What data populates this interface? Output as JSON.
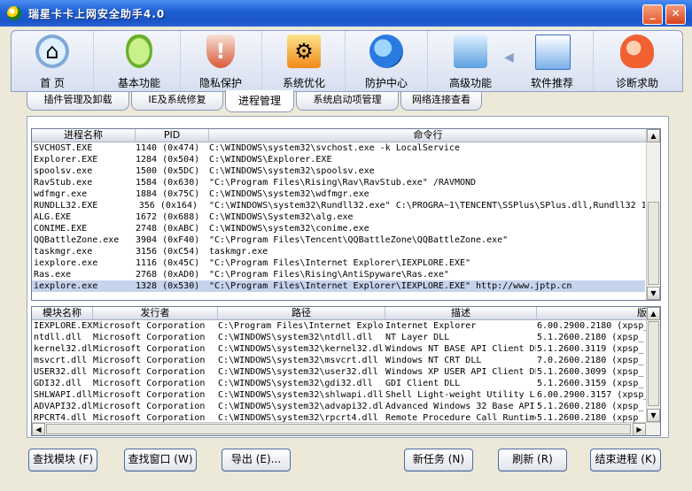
{
  "window": {
    "title": "瑞星卡卡上网安全助手4.0",
    "minimize": "_",
    "close": "✕"
  },
  "toolbar": [
    {
      "label": "首 页",
      "icon": "home-icon"
    },
    {
      "label": "基本功能",
      "icon": "mouse-icon"
    },
    {
      "label": "隐私保护",
      "icon": "shield-icon"
    },
    {
      "label": "系统优化",
      "icon": "monitor-gear-icon"
    },
    {
      "label": "防护中心",
      "icon": "globe-icon"
    },
    {
      "label": "高级功能",
      "icon": "cubes-icon"
    },
    {
      "label": "软件推荐",
      "icon": "window-icon"
    },
    {
      "label": "诊断求助",
      "icon": "heart-hand-icon"
    }
  ],
  "subtabs": [
    {
      "label": "插件管理及卸载"
    },
    {
      "label": "IE及系统修复"
    },
    {
      "label": "进程管理",
      "active": true
    },
    {
      "label": "系统启动项管理"
    },
    {
      "label": "网络连接查看"
    }
  ],
  "process_list": {
    "columns": [
      "进程名称",
      "PID",
      "命令行"
    ],
    "rows": [
      [
        "SVCHOST.EXE",
        "1140 (0x474)",
        "C:\\WINDOWS\\system32\\svchost.exe -k LocalService"
      ],
      [
        "Explorer.EXE",
        "1284 (0x504)",
        "C:\\WINDOWS\\Explorer.EXE"
      ],
      [
        "spoolsv.exe",
        "1500 (0x5DC)",
        "C:\\WINDOWS\\system32\\spoolsv.exe"
      ],
      [
        "RavStub.exe",
        "1584 (0x630)",
        "\"C:\\Program Files\\Rising\\Rav\\RavStub.exe\" /RAVMOND"
      ],
      [
        "wdfmgr.exe",
        "1884 (0x75C)",
        "C:\\WINDOWS\\system32\\wdfmgr.exe"
      ],
      [
        "RUNDLL32.EXE",
        "356 (0x164)",
        "\"C:\\WINDOWS\\system32\\Rundll32.exe\" C:\\PROGRA~1\\TENCENT\\SSPlus\\SPlus.dll,Rundll32 1"
      ],
      [
        "ALG.EXE",
        "1672 (0x688)",
        "C:\\WINDOWS\\System32\\alg.exe"
      ],
      [
        "CONIME.EXE",
        "2748 (0xABC)",
        "C:\\WINDOWS\\system32\\conime.exe"
      ],
      [
        "QQBattleZone.exe",
        "3904 (0xF40)",
        "\"C:\\Program Files\\Tencent\\QQBattleZone\\QQBattleZone.exe\""
      ],
      [
        "taskmgr.exe",
        "3156 (0xC54)",
        "taskmgr.exe"
      ],
      [
        "iexplore.exe",
        "1116 (0x45C)",
        "\"C:\\Program Files\\Internet Explorer\\IEXPLORE.EXE\""
      ],
      [
        "Ras.exe",
        "2768 (0xAD0)",
        "\"C:\\Program Files\\Rising\\AntiSpyware\\Ras.exe\""
      ],
      [
        "iexplore.exe",
        "1328 (0x530)",
        "\"C:\\Program Files\\Internet Explorer\\IEXPLORE.EXE\" http://www.jptp.cn"
      ]
    ],
    "selected_index": 12
  },
  "module_list": {
    "columns": [
      "模块名称",
      "发行者",
      "路径",
      "描述",
      "版"
    ],
    "rows": [
      [
        "IEXPLORE.EXE",
        "Microsoft Corporation",
        "C:\\Program Files\\Internet Explorer",
        "Internet Explorer",
        "6.00.2900.2180 (xpsp_"
      ],
      [
        "ntdll.dll",
        "Microsoft Corporation",
        "C:\\WINDOWS\\system32\\ntdll.dll",
        "NT Layer DLL",
        "5.1.2600.2180 (xpsp_"
      ],
      [
        "kernel32.dll",
        "Microsoft Corporation",
        "C:\\WINDOWS\\system32\\kernel32.dll",
        "Windows NT BASE API Client DLL",
        "5.1.2600.3119 (xpsp_"
      ],
      [
        "msvcrt.dll",
        "Microsoft Corporation",
        "C:\\WINDOWS\\system32\\msvcrt.dll",
        "Windows NT CRT DLL",
        "7.0.2600.2180 (xpsp_"
      ],
      [
        "USER32.dll",
        "Microsoft Corporation",
        "C:\\WINDOWS\\system32\\user32.dll",
        "Windows XP USER API Client DLL",
        "5.1.2600.3099 (xpsp_"
      ],
      [
        "GDI32.dll",
        "Microsoft Corporation",
        "C:\\WINDOWS\\system32\\gdi32.dll",
        "GDI Client DLL",
        "5.1.2600.3159 (xpsp_"
      ],
      [
        "SHLWAPI.dll",
        "Microsoft Corporation",
        "C:\\WINDOWS\\system32\\shlwapi.dll",
        "Shell Light-weight Utility Library",
        "6.00.2900.3157 (xpsp_"
      ],
      [
        "ADVAPI32.dll",
        "Microsoft Corporation",
        "C:\\WINDOWS\\system32\\advapi32.dll",
        "Advanced Windows 32 Base API",
        "5.1.2600.2180 (xpsp_"
      ],
      [
        "RPCRT4.dll",
        "Microsoft Corporation",
        "C:\\WINDOWS\\system32\\rpcrt4.dll",
        "Remote Procedure Call Runtime",
        "5.1.2600.2180 (xpsp_"
      ]
    ]
  },
  "buttons": [
    {
      "label": "查找模块 (F)",
      "name": "find-module-button"
    },
    {
      "label": "查找窗口 (W)",
      "name": "find-window-button"
    },
    {
      "label": "导出 (E)...",
      "name": "export-button"
    },
    {
      "label": "新任务 (N)",
      "name": "new-task-button"
    },
    {
      "label": "刷新 (R)",
      "name": "refresh-button"
    },
    {
      "label": "结束进程 (K)",
      "name": "end-process-button"
    }
  ]
}
